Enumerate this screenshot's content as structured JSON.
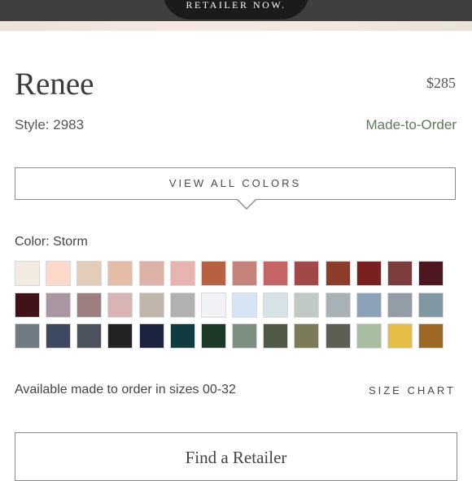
{
  "banner": {
    "text": "RETAILER NOW."
  },
  "product": {
    "name": "Renee",
    "price": "$285",
    "style": "Style: 2983",
    "order_type": "Made-to-Order"
  },
  "view_colors_label": "VIEW ALL COLORS",
  "color_label": "Color: Storm",
  "swatches": [
    "#f4ebe0",
    "#fcd9c8",
    "#e3cdb9",
    "#e5bca8",
    "#ddb2a8",
    "#e8b4b1",
    "#b86142",
    "#c4847b",
    "#c56464",
    "#a24848",
    "#8c3e2a",
    "#7a2020",
    "#7e3d3d",
    "#4e1620",
    "#431219",
    "#a996a2",
    "#9f7e80",
    "#d8b4b5",
    "#c1b6ab",
    "#b1b1b3",
    "#f1f2f5",
    "#d7e4f5",
    "#d6e2e6",
    "#c1c9c4",
    "#a8b1b3",
    "#8ba2b8",
    "#929da7",
    "#7f98a4",
    "#6f7c84",
    "#3d4a61",
    "#4c535e",
    "#232323",
    "#1b2340",
    "#103b40",
    "#1c3a27",
    "#7b9080",
    "#515a46",
    "#7c7b58",
    "#5a6154",
    "#a7bfa0",
    "#e6be46",
    "#9d6824"
  ],
  "sizes_text": "Available made to order in sizes 00-32",
  "size_chart_label": "SIZE CHART",
  "find_retailer_label": "Find a Retailer"
}
